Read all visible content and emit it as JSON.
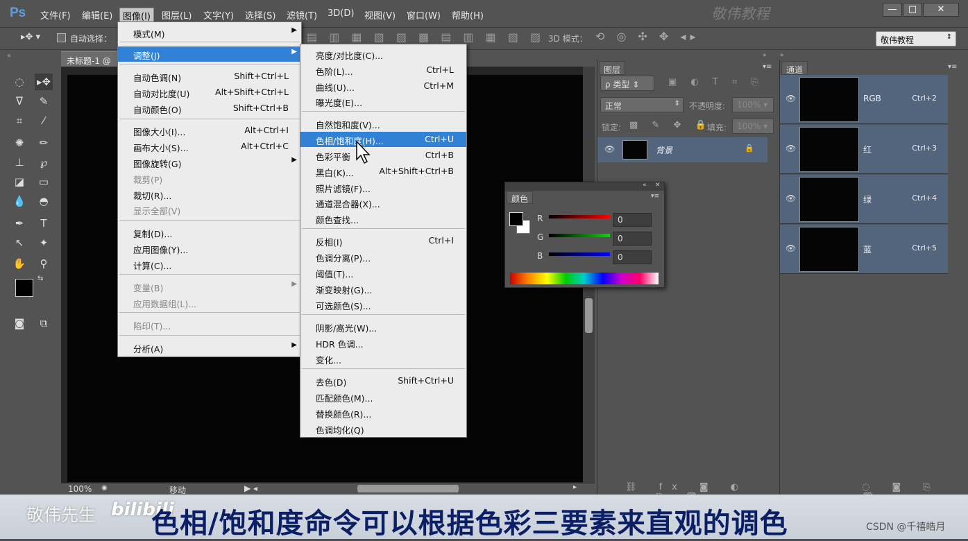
{
  "app": {
    "logo": "Ps",
    "watermark": "敬伟教程"
  },
  "menubar": [
    "文件(F)",
    "编辑(E)",
    "图像(I)",
    "图层(L)",
    "文字(Y)",
    "选择(S)",
    "滤镜(T)",
    "3D(D)",
    "视图(V)",
    "窗口(W)",
    "帮助(H)"
  ],
  "window_buttons": [
    "—",
    "□",
    "✕"
  ],
  "options": {
    "auto_select": "自动选择：",
    "mode3d": "3D 模式：",
    "workspace": "敬伟教程"
  },
  "doc": {
    "tab": "未标题-1 @",
    "zoom": "100%",
    "status": "移动"
  },
  "image_menu": [
    {
      "label": "模式(M)",
      "arrow": "▶"
    },
    {
      "label": "调整(J)",
      "arrow": "▶"
    },
    {
      "label": "自动色调(N)",
      "shortcut": "Shift+Ctrl+L"
    },
    {
      "label": "自动对比度(U)",
      "shortcut": "Alt+Shift+Ctrl+L"
    },
    {
      "label": "自动颜色(O)",
      "shortcut": "Shift+Ctrl+B"
    },
    {
      "label": "图像大小(I)...",
      "shortcut": "Alt+Ctrl+I"
    },
    {
      "label": "画布大小(S)...",
      "shortcut": "Alt+Ctrl+C"
    },
    {
      "label": "图像旋转(G)",
      "arrow": "▶"
    },
    {
      "label": "裁剪(P)"
    },
    {
      "label": "裁切(R)..."
    },
    {
      "label": "显示全部(V)"
    },
    {
      "label": "复制(D)..."
    },
    {
      "label": "应用图像(Y)..."
    },
    {
      "label": "计算(C)..."
    },
    {
      "label": "变量(B)",
      "arrow": "▶"
    },
    {
      "label": "应用数据组(L)..."
    },
    {
      "label": "陷印(T)..."
    },
    {
      "label": "分析(A)",
      "arrow": "▶"
    }
  ],
  "adjust_menu": [
    {
      "label": "亮度/对比度(C)..."
    },
    {
      "label": "色阶(L)...",
      "shortcut": "Ctrl+L"
    },
    {
      "label": "曲线(U)...",
      "shortcut": "Ctrl+M"
    },
    {
      "label": "曝光度(E)..."
    },
    {
      "label": "自然饱和度(V)..."
    },
    {
      "label": "色相/饱和度(H)...",
      "shortcut": "Ctrl+U"
    },
    {
      "label": "色彩平衡",
      "shortcut": "Ctrl+B"
    },
    {
      "label": "黑白(K)...",
      "shortcut": "Alt+Shift+Ctrl+B"
    },
    {
      "label": "照片滤镜(F)..."
    },
    {
      "label": "通道混合器(X)..."
    },
    {
      "label": "颜色查找..."
    },
    {
      "label": "反相(I)",
      "shortcut": "Ctrl+I"
    },
    {
      "label": "色调分离(P)..."
    },
    {
      "label": "阈值(T)..."
    },
    {
      "label": "渐变映射(G)..."
    },
    {
      "label": "可选颜色(S)..."
    },
    {
      "label": "阴影/高光(W)..."
    },
    {
      "label": "HDR 色调..."
    },
    {
      "label": "变化..."
    },
    {
      "label": "去色(D)",
      "shortcut": "Shift+Ctrl+U"
    },
    {
      "label": "匹配颜色(M)..."
    },
    {
      "label": "替换颜色(R)..."
    },
    {
      "label": "色调均化(Q)"
    }
  ],
  "layers": {
    "tab": "图层",
    "filter": "ρ 类型",
    "blend": "正常",
    "opacity_label": "不透明度:",
    "opacity": "100%",
    "lock_label": "锁定:",
    "fill_label": "填充:",
    "fill": "100%",
    "layer_name": "背景"
  },
  "channels": {
    "tab": "通道",
    "rows": [
      {
        "name": "RGB",
        "shortcut": "Ctrl+2"
      },
      {
        "name": "红",
        "shortcut": "Ctrl+3"
      },
      {
        "name": "绿",
        "shortcut": "Ctrl+4"
      },
      {
        "name": "蓝",
        "shortcut": "Ctrl+5"
      }
    ]
  },
  "color_panel": {
    "tab": "颜色",
    "r_label": "R",
    "g_label": "G",
    "b_label": "B",
    "r": "0",
    "g": "0",
    "b": "0"
  },
  "caption": {
    "brand": "敬伟先生",
    "bili": "bilibili",
    "text": "色相/饱和度命令可以根据色彩三要素来直观的调色"
  },
  "csdn": "CSDN @千禧皓月",
  "colors": {
    "highlight": "#3182d6",
    "channel_row": "#52657d",
    "caption_text": "#0a1f66"
  }
}
